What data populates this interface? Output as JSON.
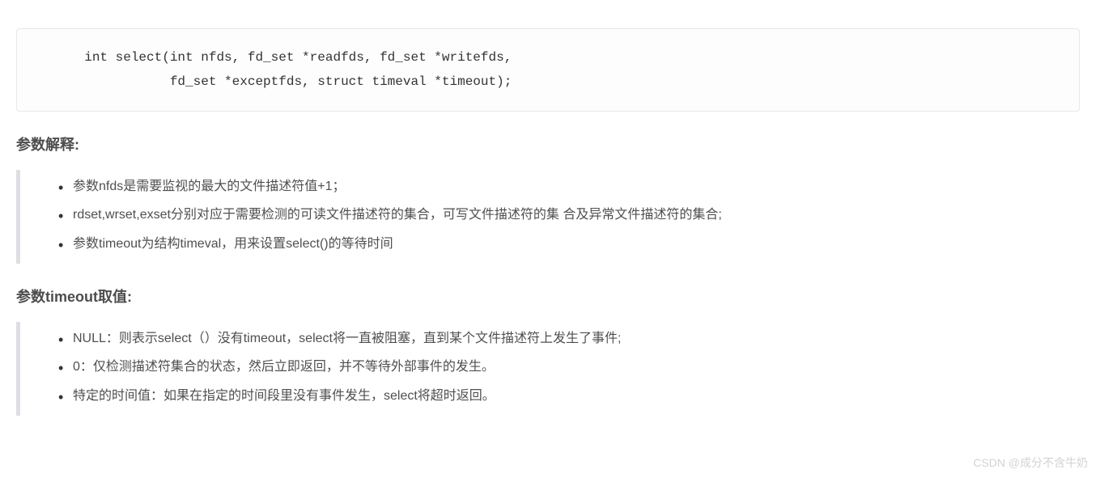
{
  "code": "       int select(int nfds, fd_set *readfds, fd_set *writefds,\n                  fd_set *exceptfds, struct timeval *timeout);",
  "section1": {
    "title": "参数解释:",
    "items": [
      "参数nfds是需要监视的最大的文件描述符值+1；",
      "rdset,wrset,exset分别对应于需要检测的可读文件描述符的集合，可写文件描述符的集 合及异常文件描述符的集合;",
      "参数timeout为结构timeval，用来设置select()的等待时间"
    ]
  },
  "section2": {
    "title": "参数timeout取值:",
    "items": [
      "NULL：则表示select（）没有timeout，select将一直被阻塞，直到某个文件描述符上发生了事件;",
      "0：仅检测描述符集合的状态，然后立即返回，并不等待外部事件的发生。",
      "特定的时间值：如果在指定的时间段里没有事件发生，select将超时返回。"
    ]
  },
  "watermark": "CSDN @成分不含牛奶"
}
